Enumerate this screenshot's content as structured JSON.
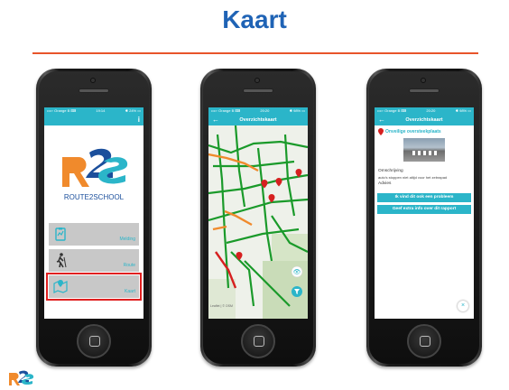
{
  "slide": {
    "title": "Kaart",
    "accent_color": "#e8552a",
    "title_color": "#1f63b5",
    "brand_teal": "#2bb5c9"
  },
  "phone1": {
    "status_left": "••••◦ Orange B ⌨",
    "status_time": "19:14",
    "status_right": "✱ 24% ▭",
    "info_icon": "info-icon",
    "logo_text": "ROUTE2SCHOOL",
    "menu": [
      {
        "label": "Melding",
        "icon": "report-clipboard-icon"
      },
      {
        "label": "Route",
        "icon": "walking-person-icon"
      },
      {
        "label": "Kaart",
        "icon": "map-pin-icon"
      }
    ]
  },
  "phone2": {
    "status_left": "••••◦ Orange B ⌨",
    "status_time": "20:20",
    "status_right": "✱ 98% ▭",
    "nav_title": "Overzichtskaart",
    "back_icon": "back-arrow-icon",
    "map_credit": "Leaflet | © OSM"
  },
  "phone3": {
    "status_left": "••••◦ Orange B ⌨",
    "status_time": "20:20",
    "status_right": "✱ 98% ▭",
    "nav_title": "Overzichtskaart",
    "issue_title": "Onveilige oversteekplaats",
    "description_label": "Omschrijving",
    "description_text": "auto's stoppen niet altijd voor het zebrapad",
    "advice_label": "Advies",
    "btn_same_problem": "Ik vind dit ook een probleem",
    "btn_extra_info": "Geef extra info over dit rapport",
    "close_label": "×"
  }
}
